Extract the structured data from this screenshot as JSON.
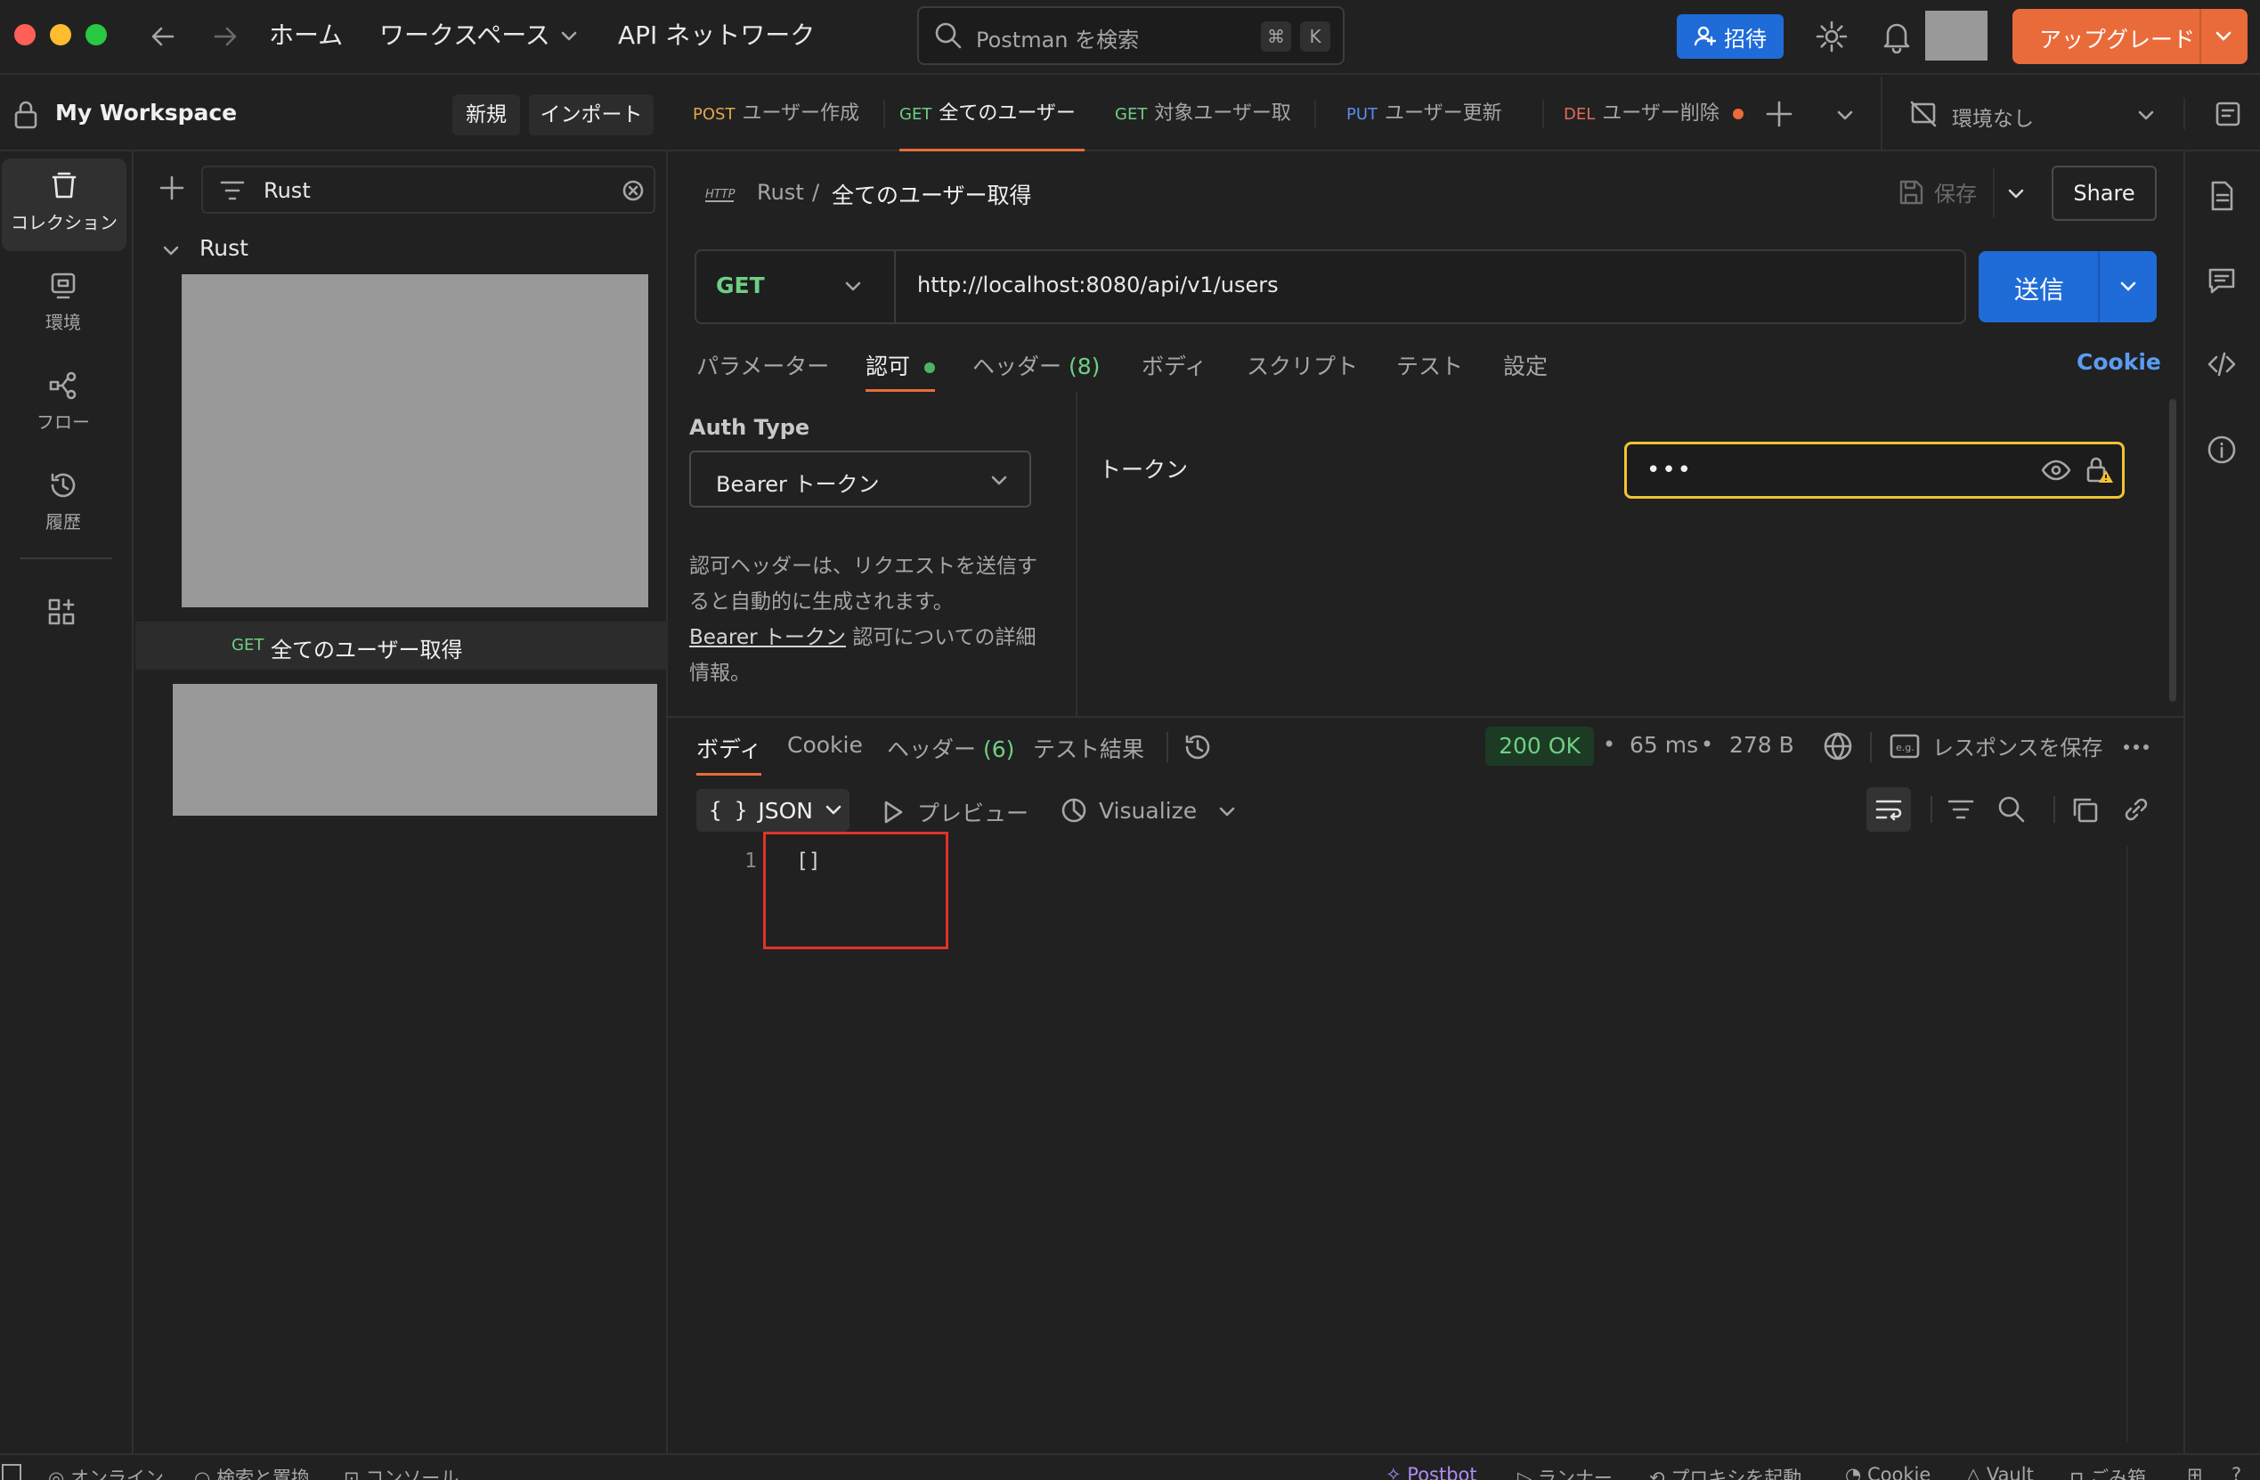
{
  "titlebar": {
    "home": "ホーム",
    "workspaces": "ワークスペース",
    "api_network": "API ネットワーク",
    "search_placeholder": "Postman を検索",
    "shortcut_cmd": "⌘",
    "shortcut_key": "K",
    "invite": "招待",
    "upgrade": "アップグレード"
  },
  "workspace": {
    "name": "My Workspace",
    "new_button": "新規",
    "import_button": "インポート"
  },
  "rail": {
    "items": [
      {
        "label": "コレクション",
        "icon": "collections-icon"
      },
      {
        "label": "環境",
        "icon": "environment-icon"
      },
      {
        "label": "フロー",
        "icon": "flows-icon"
      },
      {
        "label": "履歴",
        "icon": "history-icon"
      }
    ]
  },
  "collections": {
    "filter_value": "Rust",
    "collection_name": "Rust",
    "request_method": "GET",
    "request_name": "全てのユーザー取得"
  },
  "tabs": [
    {
      "method": "POST",
      "label": "ユーザー作成",
      "color": "#e5a84b"
    },
    {
      "method": "GET",
      "label": "全てのユーザー",
      "color": "#6fcf84"
    },
    {
      "method": "GET",
      "label": "対象ユーザー取",
      "color": "#6fcf84"
    },
    {
      "method": "PUT",
      "label": "ユーザー更新",
      "color": "#5b8def"
    },
    {
      "method": "DEL",
      "label": "ユーザー削除",
      "color": "#e06c5c"
    }
  ],
  "environment": "環境なし",
  "request": {
    "breadcrumb_collection": "Rust",
    "breadcrumb_sep": "/",
    "title": "全てのユーザー取得",
    "save": "保存",
    "share": "Share",
    "method": "GET",
    "url": "http://localhost:8080/api/v1/users",
    "send": "送信",
    "subtabs": {
      "params": "パラメーター",
      "auth": "認可",
      "headers": "ヘッダー",
      "headers_count": "(8)",
      "body": "ボディ",
      "scripts": "スクリプト",
      "tests": "テスト",
      "settings": "設定",
      "cookie": "Cookie"
    },
    "auth": {
      "type_label": "Auth Type",
      "type_value": "Bearer トークン",
      "description": "認可ヘッダーは、リクエストを送信すると自動的に生成されます。",
      "link_text": "Bearer トークン",
      "link_suffix": " 認可についての詳細情報。",
      "token_label": "トークン",
      "token_value": "•••"
    }
  },
  "response": {
    "tabs": {
      "body": "ボディ",
      "cookie": "Cookie",
      "headers": "ヘッダー",
      "headers_count": "(6)",
      "test_results": "テスト結果"
    },
    "status": "200 OK",
    "time": "65 ms",
    "size": "278 B",
    "save_response": "レスポンスを保存",
    "format": "JSON",
    "preview": "プレビュー",
    "visualize": "Visualize",
    "line_number": "1",
    "code": "[]"
  },
  "statusbar": {
    "online": "オンライン",
    "find_replace": "検索と置換",
    "console": "コンソール",
    "postbot": "Postbot",
    "runner": "ランナー",
    "proxy": "プロキシを起動",
    "cookie": "Cookie",
    "vault": "Vault",
    "trash": "ごみ箱"
  }
}
